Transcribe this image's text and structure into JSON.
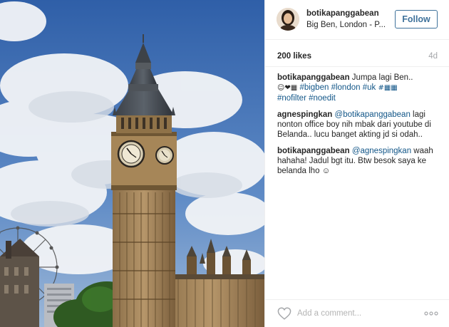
{
  "post": {
    "username": "botikapanggabean",
    "location": "Big Ben, London - P...",
    "follow_label": "Follow",
    "likes": "200 likes",
    "time_ago": "4d"
  },
  "comments": [
    {
      "user": "botikapanggabean",
      "text_lead": " Jumpa lagi Ben..",
      "emoji": "☺❤▦ ",
      "tags": [
        "#bigben",
        "#london",
        "#uk",
        "#▦▦",
        "#nofilter",
        "#noedit"
      ]
    },
    {
      "user": "agnespingkan",
      "mention": "@botikapanggabean",
      "text": " lagi nonton office boy nih mbak dari youtube di Belanda.. lucu banget akting jd si odah.."
    },
    {
      "user": "botikapanggabean",
      "mention": "@agnespingkan",
      "text": " waah hahaha! Jadul bgt itu. Btw besok saya ke belanda lho ☺"
    }
  ],
  "comment_box": {
    "placeholder": "Add a comment..."
  },
  "icons": {
    "like": "heart-outline-icon",
    "more": "ellipsis-icon"
  },
  "colors": {
    "link": "#125688",
    "follow": "#3f729b",
    "muted": "#a5a7aa"
  }
}
